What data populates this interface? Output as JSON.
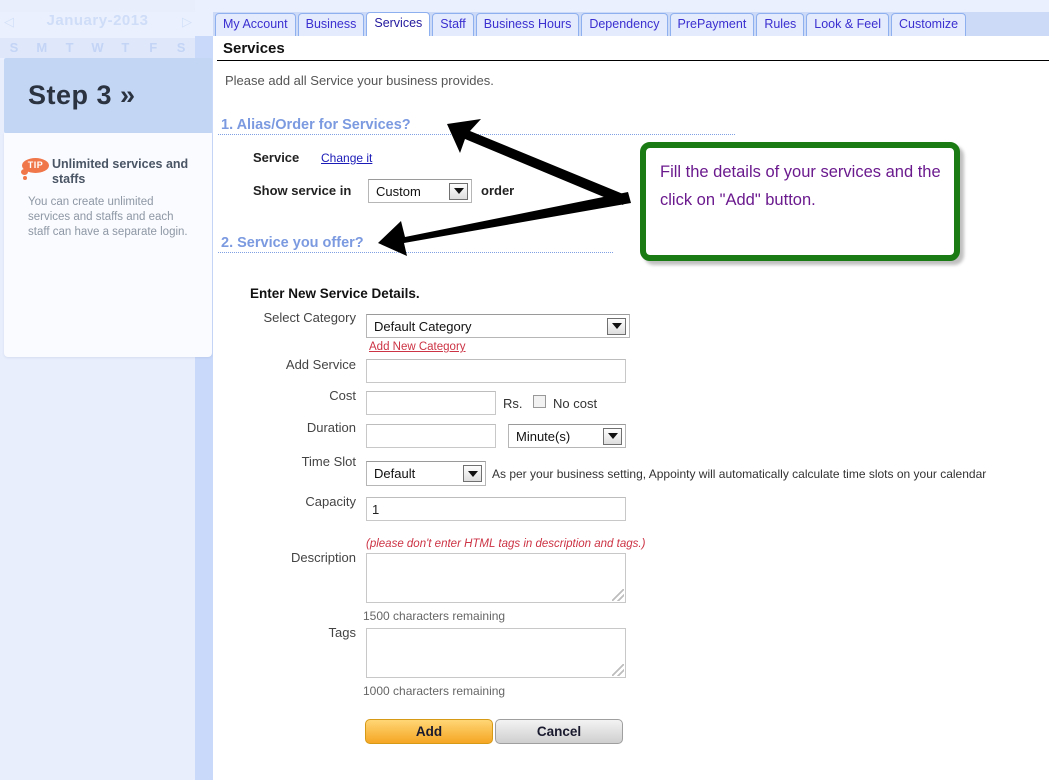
{
  "sidebar": {
    "calendar": {
      "month_label": "January-2013",
      "prev_icon": "chevron-left-icon",
      "next_icon": "chevron-right-icon",
      "day_initials": [
        "S",
        "M",
        "T",
        "W",
        "T",
        "F",
        "S"
      ]
    },
    "step": {
      "label": "Step 3 »"
    },
    "tip": {
      "badge": "TIP",
      "heading": "Unlimited services and staffs",
      "body": "You can create unlimited services and staffs and each staff can have a separate login."
    }
  },
  "tabs": [
    {
      "label": "My Account",
      "active": false
    },
    {
      "label": "Business",
      "active": false
    },
    {
      "label": "Services",
      "active": true
    },
    {
      "label": "Staff",
      "active": false
    },
    {
      "label": "Business Hours",
      "active": false
    },
    {
      "label": "Dependency",
      "active": false
    },
    {
      "label": "PrePayment",
      "active": false
    },
    {
      "label": "Rules",
      "active": false
    },
    {
      "label": "Look & Feel",
      "active": false
    },
    {
      "label": "Customize",
      "active": false
    }
  ],
  "page": {
    "title": "Services",
    "intro": "Please add all Service your business provides."
  },
  "section1": {
    "heading": "1. Alias/Order for Services?",
    "service_label": "Service",
    "change_link": "Change it",
    "show_label": "Show service in",
    "order_value": "Custom",
    "order_suffix": "order"
  },
  "section2": {
    "heading": "2. Service you offer?",
    "form_heading": "Enter New Service Details.",
    "fields": {
      "category_label": "Select Category",
      "category_value": "Default Category",
      "add_new_category": "Add New Category",
      "service_label": "Add Service",
      "service_value": "",
      "service_placeholder": "",
      "cost_label": "Cost",
      "cost_value": "",
      "cost_currency": "Rs.",
      "no_cost_label": "No cost",
      "duration_label": "Duration",
      "duration_value": "",
      "duration_unit": "Minute(s)",
      "time_slot_label": "Time Slot",
      "time_slot_value": "Default",
      "time_slot_note": "As per your business setting, Appointy will automatically calculate time slots on your calendar",
      "capacity_label": "Capacity",
      "capacity_value": "1",
      "description_label": "Description",
      "description_value": "",
      "description_note": "(please don't enter HTML tags in description and tags.)",
      "description_remaining": "1500 characters remaining",
      "tags_label": "Tags",
      "tags_value": "",
      "tags_remaining": "1000 characters remaining"
    },
    "buttons": {
      "add": "Add",
      "cancel": "Cancel"
    }
  },
  "callout": {
    "text": "Fill the details of your services and the click on \"Add\" button.",
    "border_color": "#1a7a14",
    "text_color": "#6b1a8e"
  },
  "colors": {
    "tab_active_bg": "#ffffff",
    "tab_bg": "#e3ebfd",
    "tab_text": "#3b2fd0",
    "section_heading": "#7b9ae0",
    "add_button": "#f5a623",
    "tip_accent": "#f0774a"
  }
}
